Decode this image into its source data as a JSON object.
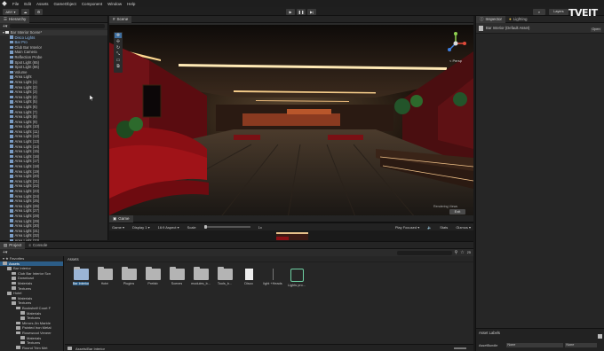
{
  "menu": {
    "items": [
      "File",
      "Edit",
      "Assets",
      "GameObject",
      "Component",
      "Window",
      "Help"
    ]
  },
  "toolbar": {
    "account_label": "ABY",
    "layers_label": "Layers",
    "layout_label": "Layout",
    "watermark": "TVEIT"
  },
  "hierarchy": {
    "tab_label": "Hierarchy",
    "items": [
      {
        "label": "Bar Interior Scene*",
        "indent": 0,
        "scene": true
      },
      {
        "label": "Disco Lights",
        "indent": 1,
        "sel": true
      },
      {
        "label": "Bar Pro",
        "indent": 1,
        "sel": true
      },
      {
        "label": "Club Bar Interior",
        "indent": 1
      },
      {
        "label": "Main Camera",
        "indent": 1
      },
      {
        "label": "Reflection Probe",
        "indent": 1
      },
      {
        "label": "Spot Light (65)",
        "indent": 1
      },
      {
        "label": "Spot Light (66)",
        "indent": 1
      },
      {
        "label": "Volume",
        "indent": 1
      },
      {
        "label": "Area Light",
        "indent": 1
      },
      {
        "label": "Area Light (1)",
        "indent": 1
      },
      {
        "label": "Area Light (2)",
        "indent": 1
      },
      {
        "label": "Area Light (3)",
        "indent": 1
      },
      {
        "label": "Area Light (4)",
        "indent": 1
      },
      {
        "label": "Area Light (5)",
        "indent": 1
      },
      {
        "label": "Area Light (6)",
        "indent": 1
      },
      {
        "label": "Area Light (7)",
        "indent": 1
      },
      {
        "label": "Area Light (8)",
        "indent": 1
      },
      {
        "label": "Area Light (9)",
        "indent": 1
      },
      {
        "label": "Area Light (10)",
        "indent": 1
      },
      {
        "label": "Area Light (11)",
        "indent": 1
      },
      {
        "label": "Area Light (12)",
        "indent": 1
      },
      {
        "label": "Area Light (13)",
        "indent": 1
      },
      {
        "label": "Area Light (14)",
        "indent": 1
      },
      {
        "label": "Area Light (15)",
        "indent": 1
      },
      {
        "label": "Area Light (16)",
        "indent": 1
      },
      {
        "label": "Area Light (17)",
        "indent": 1
      },
      {
        "label": "Area Light (18)",
        "indent": 1
      },
      {
        "label": "Area Light (19)",
        "indent": 1
      },
      {
        "label": "Area Light (20)",
        "indent": 1
      },
      {
        "label": "Area Light (21)",
        "indent": 1
      },
      {
        "label": "Area Light (22)",
        "indent": 1
      },
      {
        "label": "Area Light (23)",
        "indent": 1
      },
      {
        "label": "Area Light (24)",
        "indent": 1
      },
      {
        "label": "Area Light (25)",
        "indent": 1
      },
      {
        "label": "Area Light (26)",
        "indent": 1
      },
      {
        "label": "Area Light (27)",
        "indent": 1
      },
      {
        "label": "Area Light (28)",
        "indent": 1
      },
      {
        "label": "Area Light (29)",
        "indent": 1
      },
      {
        "label": "Area Light (30)",
        "indent": 1
      },
      {
        "label": "Area Light (31)",
        "indent": 1
      },
      {
        "label": "Area Light (32)",
        "indent": 1
      },
      {
        "label": "Area Light (33)",
        "indent": 1
      }
    ]
  },
  "scene": {
    "tab_label": "Scene",
    "persp_label": "< Persp",
    "rendering_label": "Rendering Views",
    "exit_label": "Exit"
  },
  "game": {
    "tab_label": "Game",
    "mode": "Game",
    "display": "Display 1",
    "aspect": "16:9 Aspect",
    "scale_label": "Scale",
    "scale_value": "1x",
    "play_focused": "Play Focused",
    "stats": "Stats",
    "gizmos": "Gizmos"
  },
  "inspector": {
    "tab_label": "Inspector",
    "lighting_label": "Lighting",
    "title": "Bar Interior (Default Asset)",
    "open_label": "Open",
    "asset_labels": "Asset Labels",
    "assetbundle_label": "AssetBundle",
    "none_1": "None",
    "none_2": "None"
  },
  "project": {
    "tab_project": "Project",
    "tab_console": "Console",
    "favorites_label": "Favorites",
    "assets_header": "Assets",
    "breadcrumb": "Assets/Bar Interior",
    "badge_count": "25",
    "tree": [
      {
        "label": "Assets",
        "indent": 0,
        "sel": true
      },
      {
        "label": "Bar Interior",
        "indent": 1
      },
      {
        "label": "Club Bar Interior Scn",
        "indent": 2
      },
      {
        "label": "Download",
        "indent": 2
      },
      {
        "label": "Materials",
        "indent": 2
      },
      {
        "label": "Textures",
        "indent": 2
      },
      {
        "label": "Hotel",
        "indent": 1
      },
      {
        "label": "Materials",
        "indent": 2
      },
      {
        "label": "Textures",
        "indent": 2
      },
      {
        "label": "Bookshelf Court F",
        "indent": 3
      },
      {
        "label": "Materials",
        "indent": 4
      },
      {
        "label": "Textures",
        "indent": 4
      },
      {
        "label": "Mirrors Jin Marble",
        "indent": 3
      },
      {
        "label": "Painted Iron Metal",
        "indent": 3
      },
      {
        "label": "Rosewood Veneer",
        "indent": 3
      },
      {
        "label": "Materials",
        "indent": 4
      },
      {
        "label": "Textures",
        "indent": 4
      },
      {
        "label": "Round Trim Met",
        "indent": 3
      }
    ],
    "assets": [
      {
        "label": "Bar Interior",
        "kind": "folder",
        "sel": true
      },
      {
        "label": "Hotel",
        "kind": "folder"
      },
      {
        "label": "Plugins",
        "kind": "folder"
      },
      {
        "label": "Prefab",
        "kind": "folder"
      },
      {
        "label": "Scenes",
        "kind": "folder"
      },
      {
        "label": "modules_b...",
        "kind": "folder"
      },
      {
        "label": "Tools_b...",
        "kind": "folder"
      },
      {
        "label": "Disco",
        "kind": "doc"
      },
      {
        "label": "light +Heads",
        "kind": "light"
      },
      {
        "label": "Lights pro...",
        "kind": "prefab"
      }
    ]
  },
  "colors": {
    "accent": "#2c5d87",
    "panel": "#282828",
    "seat_red": "#8a0f14",
    "ceiling_light": "#ffe2a0",
    "lighting_icon": "#6fd1a4"
  }
}
